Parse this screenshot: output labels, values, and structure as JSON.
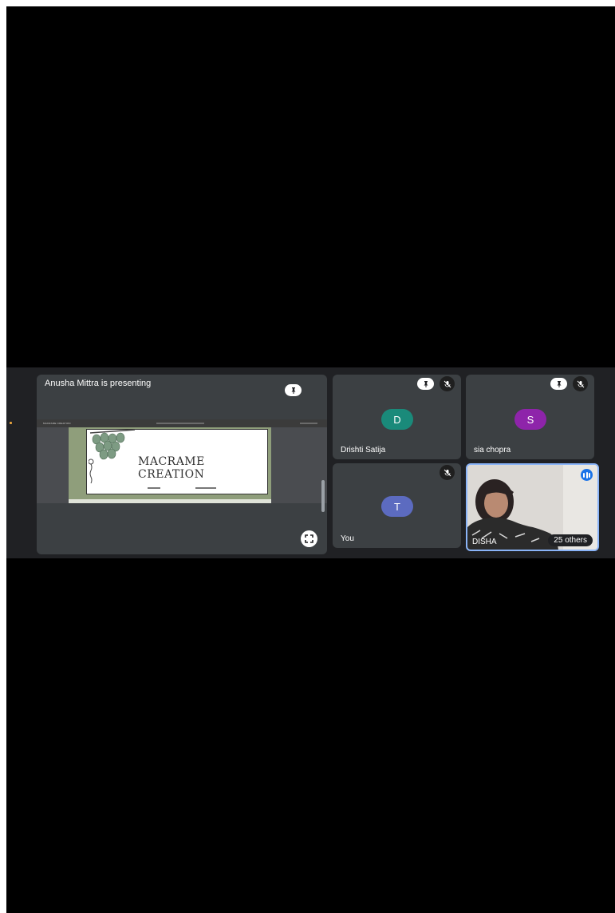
{
  "presentation": {
    "presenter_label": "Anusha Mittra is presenting",
    "toolbar_doc_name": "MACRAME CREATION",
    "slide_title": "MACRAME CREATION"
  },
  "participants": [
    {
      "name": "Drishti Satija",
      "initial": "D",
      "avatar_color": "#1a8a7a",
      "muted": true,
      "pinned": true
    },
    {
      "name": "sia chopra",
      "initial": "S",
      "avatar_color": "#8e24aa",
      "muted": true,
      "pinned": true
    },
    {
      "name": "You",
      "initial": "T",
      "avatar_color": "#5c6bc0",
      "muted": true
    }
  ],
  "featured_participant": {
    "name": "DISHA",
    "others_label": "25 others",
    "speaking": true
  },
  "colors": {
    "tile_bg": "#3c4043",
    "band_bg": "#202124",
    "active_border": "#8ab4f8"
  },
  "icons": [
    "pin-icon",
    "mic-off-icon",
    "fullscreen-icon",
    "speaking-indicator-icon"
  ]
}
